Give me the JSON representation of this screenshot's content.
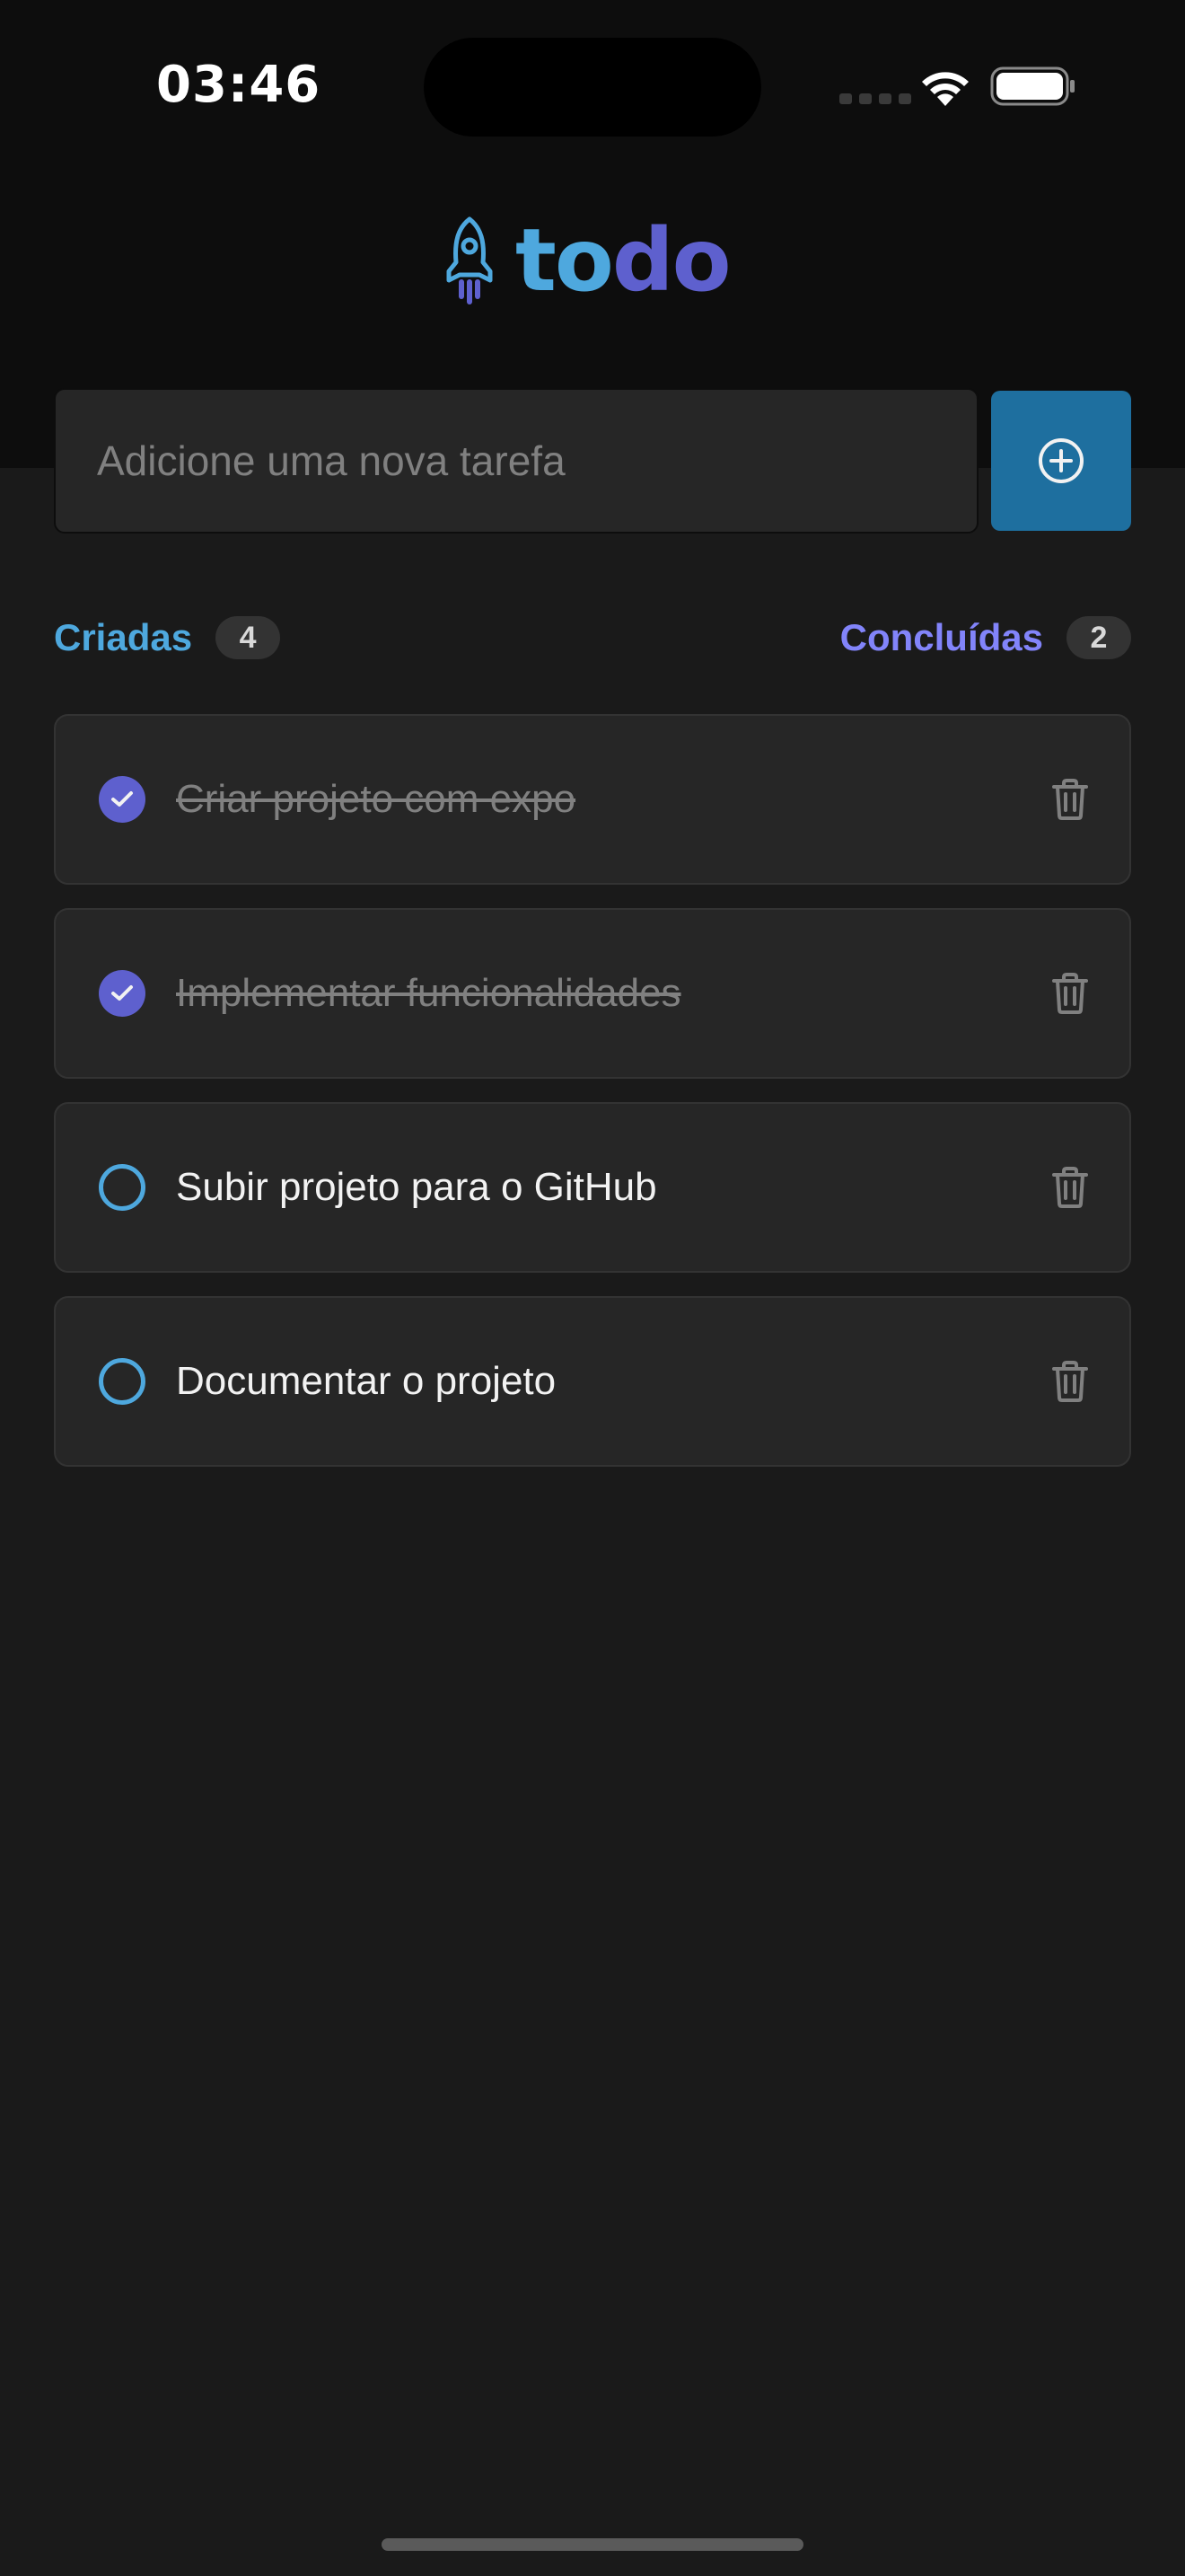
{
  "status_bar": {
    "time": "03:46"
  },
  "logo": {
    "part1": "to",
    "part2": "do",
    "icon": "rocket-icon"
  },
  "new_task": {
    "placeholder": "Adicione uma nova tarefa",
    "value": "",
    "add_icon": "plus-circle-icon"
  },
  "counters": {
    "created_label": "Criadas",
    "created_count": "4",
    "done_label": "Concluídas",
    "done_count": "2"
  },
  "tasks": [
    {
      "text": "Criar projeto com expo",
      "done": true
    },
    {
      "text": "Implementar funcionalidades",
      "done": true
    },
    {
      "text": "Subir projeto para o GitHub",
      "done": false
    },
    {
      "text": "Documentar o projeto",
      "done": false
    }
  ],
  "colors": {
    "background": "#1a1a1a",
    "header": "#0d0d0d",
    "blue": "#4ea8de",
    "blue_dark": "#1e6f9f",
    "purple": "#5e60ce",
    "purple_light": "#8284fa",
    "card": "#262626"
  }
}
